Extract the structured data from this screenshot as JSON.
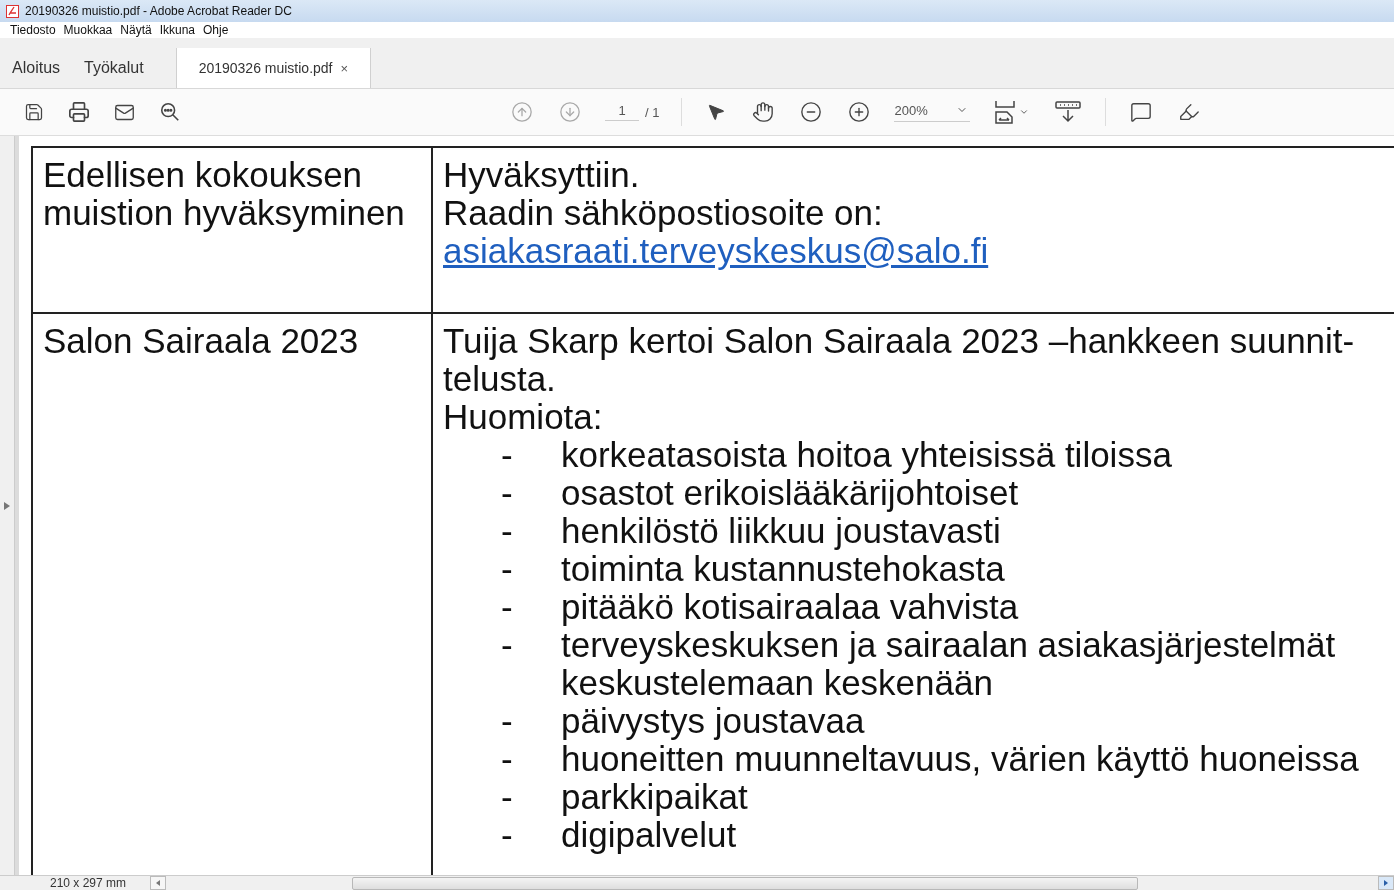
{
  "window": {
    "title": "20190326 muistio.pdf - Adobe Acrobat Reader DC"
  },
  "menu": [
    "Tiedosto",
    "Muokkaa",
    "Näytä",
    "Ikkuna",
    "Ohje"
  ],
  "tabs": [
    {
      "label": "Aloitus",
      "selected": false
    },
    {
      "label": "Työkalut",
      "selected": false
    },
    {
      "label": "20190326 muistio.pdf",
      "selected": true,
      "close": "×"
    }
  ],
  "toolbar": {
    "nav_disabled": true,
    "page_field": "1",
    "page_total": "/ 1",
    "zoom": "200%"
  },
  "document": {
    "rows": [
      {
        "topic": "Edellisen kokouksen muistion hyväksyminen",
        "content": [
          {
            "kind": "text",
            "text": "Hyväksyttiin."
          },
          {
            "kind": "text",
            "text": "Raadin sähköpostiosoite on:"
          },
          {
            "kind": "link",
            "text": "asiakasraati.terveyskeskus@salo.fi"
          }
        ]
      },
      {
        "topic": "Salon Sairaala 2023",
        "content": [
          {
            "kind": "text",
            "text": "Tuija Skarp kertoi Salon Sairaala 2023 –hankkeen suunnit-telusta."
          },
          {
            "kind": "text",
            "text": "Huomiota:"
          },
          {
            "kind": "list",
            "items": [
              {
                "bullet": "-",
                "text": "korkeatasoista hoitoa yhteisissä tiloissa"
              },
              {
                "bullet": "-",
                "text": "osastot erikoislääkärijohtoiset"
              },
              {
                "bullet": "-",
                "text": "henkilöstö liikkuu joustavasti"
              },
              {
                "bullet": "-",
                "text": "toiminta kustannustehokasta"
              },
              {
                "bullet": "-",
                "text": "pitääkö kotisairaalaa vahvista"
              },
              {
                "bullet": "-",
                "text": "terveyskeskuksen ja sairaalan asiakasjärjestelmät keskustelemaan keskenään"
              },
              {
                "bullet": "-",
                "text": "päivystys joustavaa"
              },
              {
                "bullet": "-",
                "text": "huoneitten muunneltavuus, värien käyttö huoneissa"
              },
              {
                "bullet": "-",
                "text": "parkkipaikat"
              },
              {
                "bullet": "-",
                "text": "digipalvelut"
              }
            ]
          }
        ]
      }
    ]
  },
  "status_bar": {
    "page_size": "210 x 297 mm"
  }
}
